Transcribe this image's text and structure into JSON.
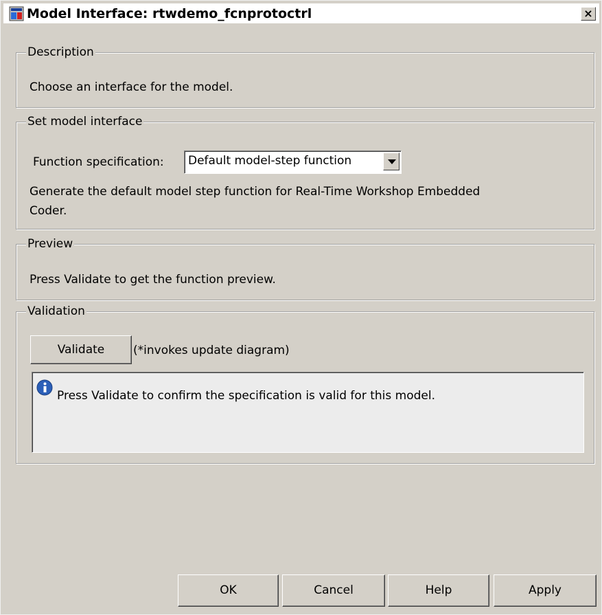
{
  "window": {
    "title": "Model Interface: rtwdemo_fcnprotoctrl",
    "close_glyph": "×"
  },
  "description": {
    "legend": "Description",
    "text": "Choose an interface for the model."
  },
  "set_interface": {
    "legend": "Set model interface",
    "function_spec_label": "Function specification:",
    "function_spec_value": "Default model-step function",
    "help_text_line1": "Generate the default model step function for Real-Time Workshop Embedded",
    "help_text_line2": "Coder."
  },
  "preview": {
    "legend": "Preview",
    "text": "Press Validate to get the function preview."
  },
  "validation": {
    "legend": "Validation",
    "validate_button": "Validate",
    "note": "(*invokes update diagram)",
    "message": "Press Validate to confirm the specification is valid for this model."
  },
  "buttons": {
    "ok": "OK",
    "cancel": "Cancel",
    "help": "Help",
    "apply": "Apply"
  },
  "icons": {
    "app": "simulink-model-icon",
    "info": "info-icon",
    "close": "close-icon",
    "dropdown": "chevron-down-icon"
  },
  "colors": {
    "window_bg": "#d4d0c8",
    "info_icon": "#2b5fb8"
  }
}
